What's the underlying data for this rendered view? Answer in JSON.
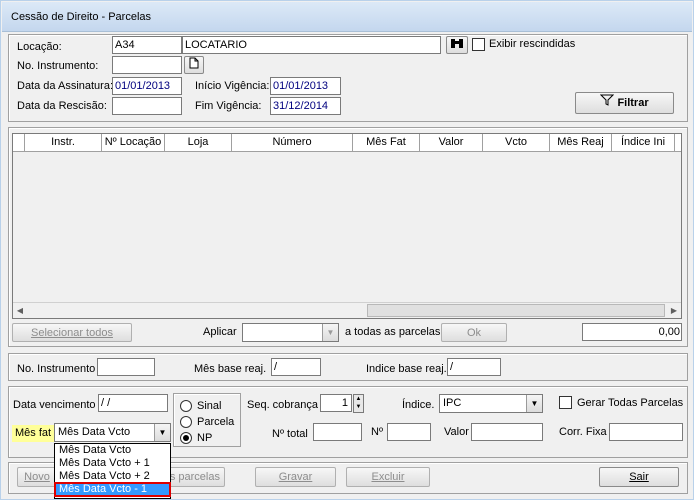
{
  "window": {
    "title": "Cessão de Direito - Parcelas"
  },
  "header": {
    "locacao_label": "Locação:",
    "locacao_code": "A34",
    "locacao_name": "LOCATARIO",
    "exibir_rescindidas_label": "Exibir rescindidas",
    "no_instrumento_label": "No. Instrumento:",
    "no_instrumento_value": "",
    "data_assinatura_label": "Data da Assinatura:",
    "data_assinatura_value": "01/01/2013",
    "inicio_vigencia_label": "Início Vigência:",
    "inicio_vigencia_value": "01/01/2013",
    "data_rescisao_label": "Data da Rescisão:",
    "data_rescisao_value": "",
    "fim_vigencia_label": "Fim Vigência:",
    "fim_vigencia_value": "31/12/2014",
    "filtrar_label": "Filtrar"
  },
  "grid": {
    "columns": [
      "Instr.",
      "Nº Locação",
      "Loja",
      "Número",
      "Mês Fat",
      "Valor",
      "Vcto",
      "Mês Reaj",
      "Índice Ini"
    ],
    "rows": []
  },
  "grid_footer": {
    "selecionar_todos": "Selecionar todos",
    "aplicar_label": "Aplicar",
    "aplicar_value": "",
    "a_todas_label": "a todas as parcelas",
    "ok_label": "Ok",
    "total_value": "0,00"
  },
  "instrument_panel": {
    "no_instrumento_label": "No. Instrumento",
    "no_instrumento_value": "",
    "mes_base_label": "Mês base reaj.",
    "mes_base_value": " /",
    "indice_base_label": "Indice base reaj.",
    "indice_base_value": " /"
  },
  "parcel_panel": {
    "data_vencimento_label": "Data vencimento",
    "data_vencimento_value": " / /",
    "mes_fat_label": "Mês fat",
    "mes_fat_value": "Mês Data Vcto",
    "mes_fat_options": [
      "Mês Data Vcto",
      "Mês Data Vcto + 1",
      "Mês Data Vcto + 2",
      "Mês Data Vcto - 1"
    ],
    "radio_sinal": "Sinal",
    "radio_parcela": "Parcela",
    "radio_np": "NP",
    "seq_cobranca_label": "Seq. cobrança",
    "seq_cobranca_value": "1",
    "indice_label": "Índice.",
    "indice_value": "IPC",
    "gerar_todas_label": "Gerar Todas Parcelas",
    "n_total_label": "Nº total",
    "n_total_value": "",
    "n_label": "Nº",
    "n_value": "",
    "valor_label": "Valor",
    "valor_value": "",
    "corr_fixa_label": "Corr. Fixa",
    "corr_fixa_value": ""
  },
  "footer": {
    "novo_label": "Novo",
    "parcelas_label": "as parcelas",
    "gravar_label": "Gravar",
    "excluir_label": "Excluir",
    "sair_label": "Sair"
  },
  "colors": {
    "selection": "#3399ff",
    "highlight_border": "#dd0000",
    "label_highlight": "#ffff99"
  }
}
